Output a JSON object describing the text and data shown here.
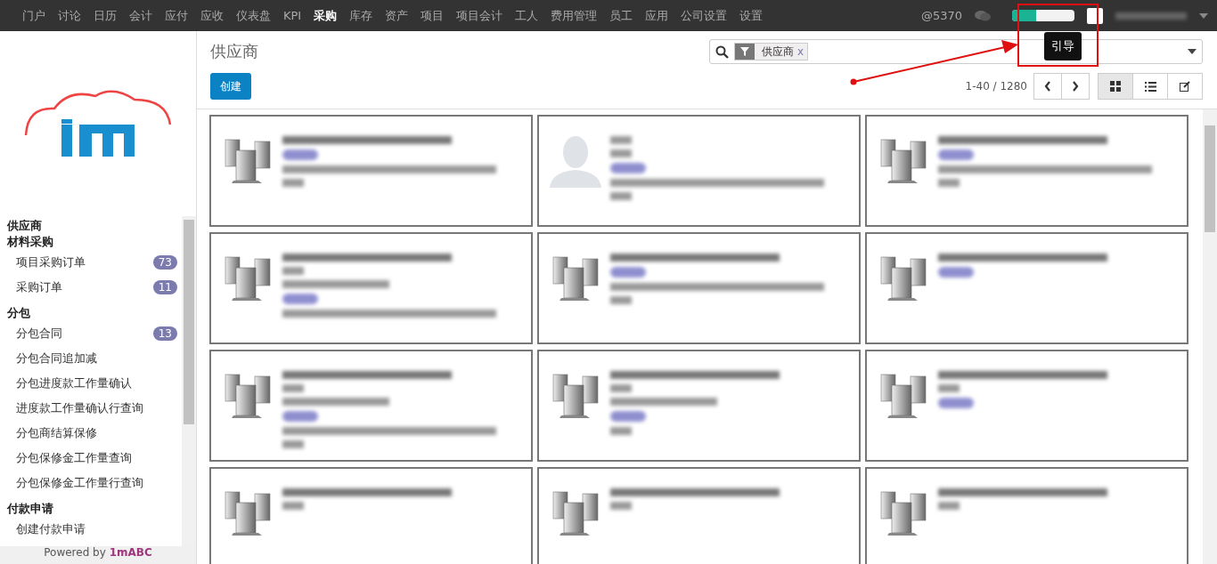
{
  "top_nav": {
    "items": [
      {
        "label": "门户",
        "selected": false
      },
      {
        "label": "讨论",
        "selected": false
      },
      {
        "label": "日历",
        "selected": false
      },
      {
        "label": "会计",
        "selected": false
      },
      {
        "label": "应付",
        "selected": false
      },
      {
        "label": "应收",
        "selected": false
      },
      {
        "label": "仪表盘",
        "selected": false
      },
      {
        "label": "KPI",
        "selected": false
      },
      {
        "label": "采购",
        "selected": true
      },
      {
        "label": "库存",
        "selected": false
      },
      {
        "label": "资产",
        "selected": false
      },
      {
        "label": "项目",
        "selected": false
      },
      {
        "label": "项目会计",
        "selected": false
      },
      {
        "label": "工人",
        "selected": false
      },
      {
        "label": "费用管理",
        "selected": false
      },
      {
        "label": "员工",
        "selected": false
      },
      {
        "label": "应用",
        "selected": false
      },
      {
        "label": "公司设置",
        "selected": false
      },
      {
        "label": "设置",
        "selected": false
      }
    ],
    "mentions": "@5370",
    "progress": {
      "level": 0.38
    },
    "tooltip": "引导"
  },
  "sidebar": {
    "sections": [
      {
        "title": "供应商"
      },
      {
        "title": "材料采购",
        "items": [
          {
            "label": "项目采购订单",
            "badge": "73"
          },
          {
            "label": "采购订单",
            "badge": "11"
          }
        ]
      },
      {
        "title": "分包",
        "items": [
          {
            "label": "分包合同",
            "badge": "13"
          },
          {
            "label": "分包合同追加减"
          },
          {
            "label": "分包进度款工作量确认"
          },
          {
            "label": "进度款工作量确认行查询"
          },
          {
            "label": "分包商结算保修"
          },
          {
            "label": "分包保修金工作量查询"
          },
          {
            "label": "分包保修金工作量行查询"
          }
        ]
      },
      {
        "title": "付款申请",
        "items": [
          {
            "label": "创建付款申请"
          }
        ]
      }
    ],
    "footer_text": "Powered by ",
    "footer_brand": "1mABC"
  },
  "page": {
    "title": "供应商",
    "create_button": "创建",
    "search": {
      "facet": "供应商",
      "remove": "x"
    },
    "pager": "1-40 / 1280",
    "views": [
      {
        "kind": "kanban",
        "selected": true
      },
      {
        "kind": "list",
        "selected": false
      },
      {
        "kind": "form",
        "selected": false
      }
    ]
  },
  "cards": [
    {
      "kind": "company"
    },
    {
      "kind": "person"
    },
    {
      "kind": "company"
    },
    {
      "kind": "company"
    },
    {
      "kind": "company"
    },
    {
      "kind": "company"
    },
    {
      "kind": "company"
    },
    {
      "kind": "company"
    },
    {
      "kind": "company"
    },
    {
      "kind": "company"
    },
    {
      "kind": "company"
    },
    {
      "kind": "company"
    }
  ]
}
